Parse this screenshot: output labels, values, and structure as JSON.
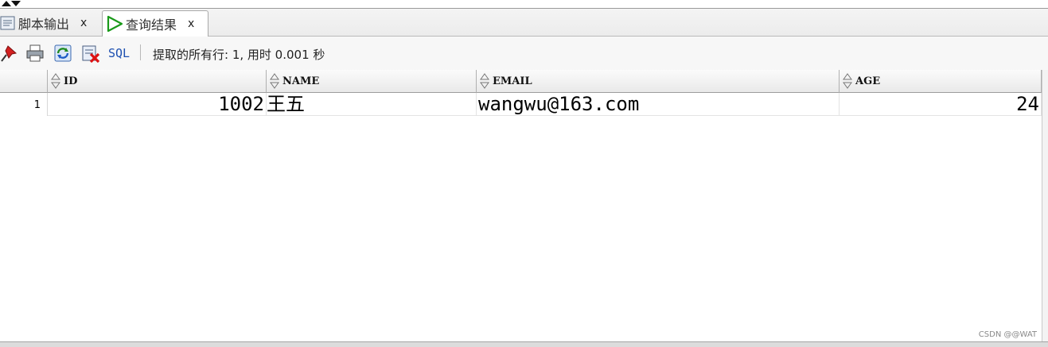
{
  "tabs": {
    "output_label": "脚本输出",
    "results_label": "查询结果",
    "close_glyph": "x"
  },
  "toolbar": {
    "sql_label": "SQL",
    "status_text": "提取的所有行: 1, 用时 0.001 秒"
  },
  "grid": {
    "columns": [
      "ID",
      "NAME",
      "EMAIL",
      "AGE"
    ],
    "rows": [
      {
        "row_number": "1",
        "id": "1002",
        "name": "王五",
        "email": "wangwu@163.com",
        "age": "24"
      }
    ]
  },
  "watermark": "CSDN @@WAT",
  "icons": [
    "collapse-icon",
    "script-output-icon",
    "run-icon",
    "pin-icon",
    "print-icon",
    "refresh-icon",
    "clear-icon",
    "sort-icon"
  ]
}
